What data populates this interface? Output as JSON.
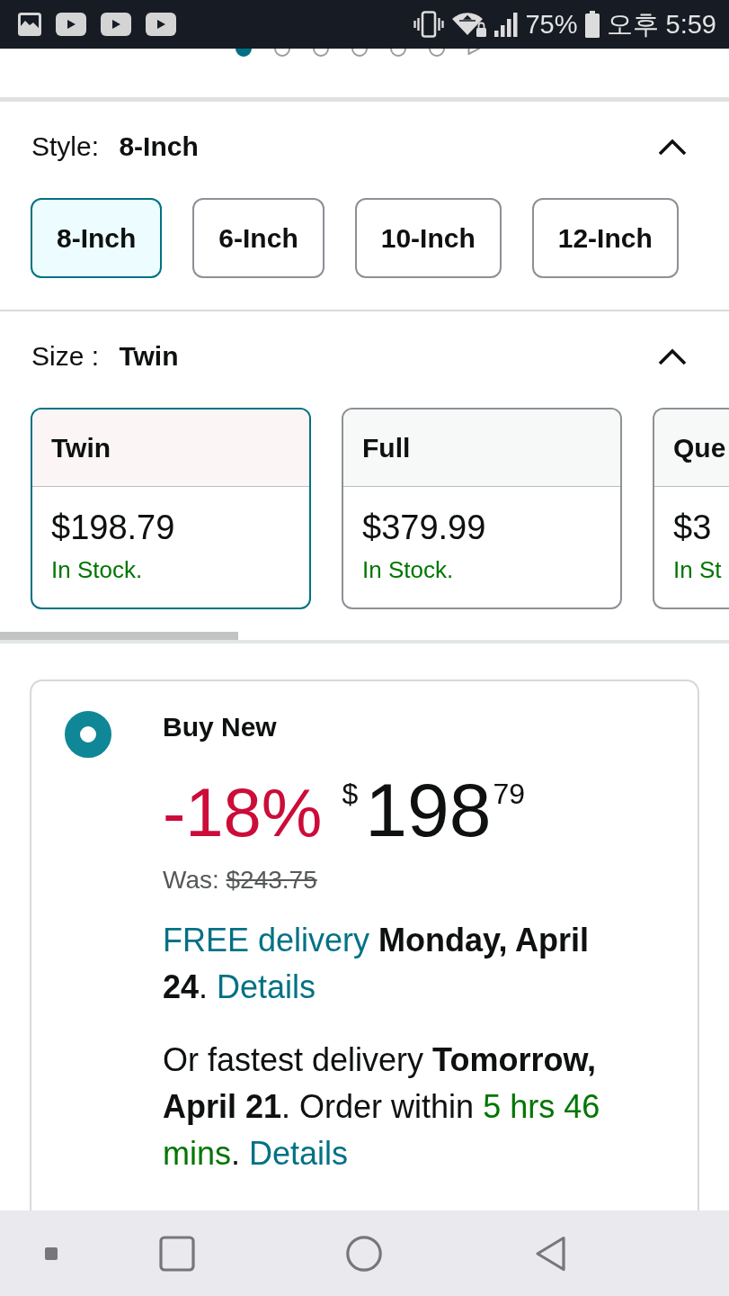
{
  "status_bar": {
    "battery": "75%",
    "time": "오후 5:59"
  },
  "carousel": {
    "dots": [
      {
        "selected": true
      },
      {
        "selected": false
      },
      {
        "selected": false
      },
      {
        "selected": false
      },
      {
        "selected": false
      },
      {
        "selected": false
      }
    ]
  },
  "style_selector": {
    "label": "Style:",
    "value": "8-Inch",
    "expanded": true,
    "options": [
      {
        "label": "8-Inch",
        "selected": true
      },
      {
        "label": "6-Inch",
        "selected": false
      },
      {
        "label": "10-Inch",
        "selected": false
      },
      {
        "label": "12-Inch",
        "selected": false
      }
    ]
  },
  "size_selector": {
    "label": "Size :",
    "value": "Twin",
    "expanded": true,
    "options": [
      {
        "name": "Twin",
        "price": "$198.79",
        "availability": "In Stock.",
        "selected": true
      },
      {
        "name": "Full",
        "price": "$379.99",
        "availability": "In Stock.",
        "selected": false
      },
      {
        "name": "Que",
        "price": "$3",
        "availability": "In St",
        "selected": false
      }
    ]
  },
  "buy_box": {
    "option_label": "Buy New",
    "selected": true,
    "discount": "-18%",
    "price": {
      "currency": "$",
      "whole": "198",
      "fraction": "79"
    },
    "was_label": "Was:",
    "was_price": "$243.75",
    "delivery": [
      {
        "segments": [
          {
            "kind": "link",
            "text": "FREE delivery"
          },
          {
            "kind": "bold",
            "text": " Monday, April 24"
          },
          {
            "kind": "plain",
            "text": ". "
          },
          {
            "kind": "link",
            "text": "Details"
          }
        ]
      },
      {
        "segments": [
          {
            "kind": "plain",
            "text": "Or fastest delivery "
          },
          {
            "kind": "bold",
            "text": "Tomorrow, April 21"
          },
          {
            "kind": "plain",
            "text": ". Order within "
          },
          {
            "kind": "urgent",
            "text": "5 hrs 46 mins"
          },
          {
            "kind": "plain",
            "text": ". "
          },
          {
            "kind": "link",
            "text": "Details"
          }
        ]
      }
    ]
  }
}
